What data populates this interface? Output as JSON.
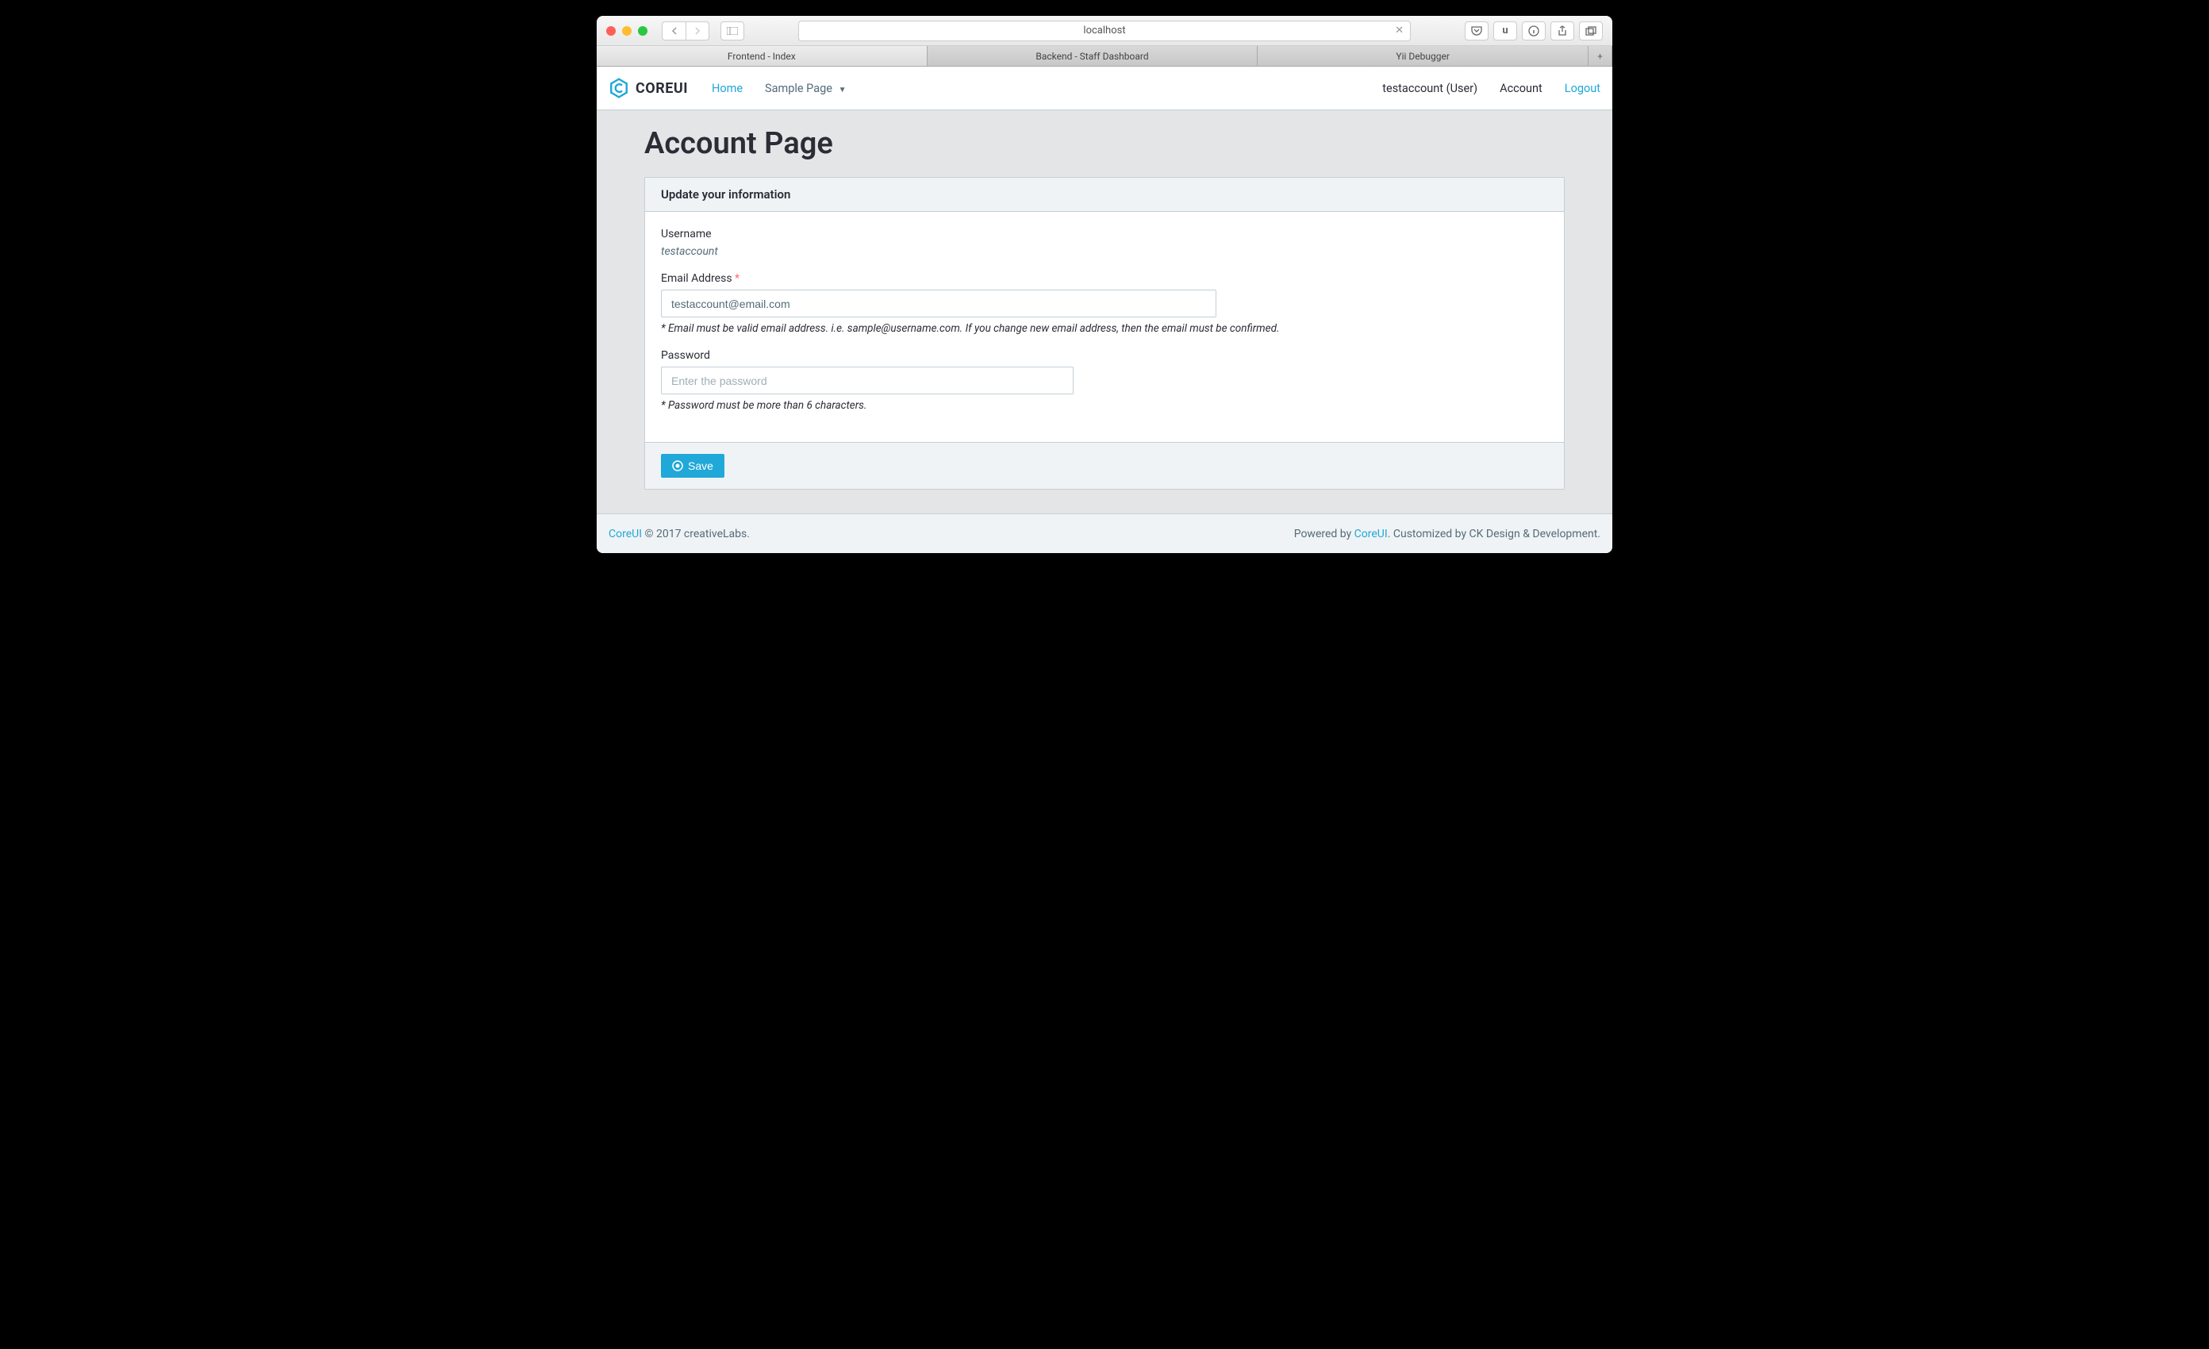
{
  "browser": {
    "url": "localhost",
    "tabs": [
      "Frontend - Index",
      "Backend - Staff Dashboard",
      "Yii Debugger"
    ],
    "active_tab_index": 0
  },
  "header": {
    "brand": "COREUI",
    "nav_left": {
      "home": "Home",
      "sample_page": "Sample Page"
    },
    "nav_right": {
      "user_label": "testaccount (User)",
      "account": "Account",
      "logout": "Logout"
    }
  },
  "page": {
    "title": "Account Page",
    "card_header": "Update your information",
    "fields": {
      "username": {
        "label": "Username",
        "value": "testaccount"
      },
      "email": {
        "label": "Email Address",
        "value": "testaccount@email.com",
        "help": "* Email must be valid email address. i.e. sample@username.com. If you change new email address, then the email must be confirmed."
      },
      "password": {
        "label": "Password",
        "placeholder": "Enter the password",
        "help": "* Password must be more than 6 characters."
      }
    },
    "save_label": "Save"
  },
  "footer": {
    "brand_link": "CoreUI",
    "copyright": " © 2017 creativeLabs.",
    "powered_prefix": "Powered by ",
    "powered_link": "CoreUI",
    "powered_suffix": ". Customized by CK Design & Development."
  }
}
